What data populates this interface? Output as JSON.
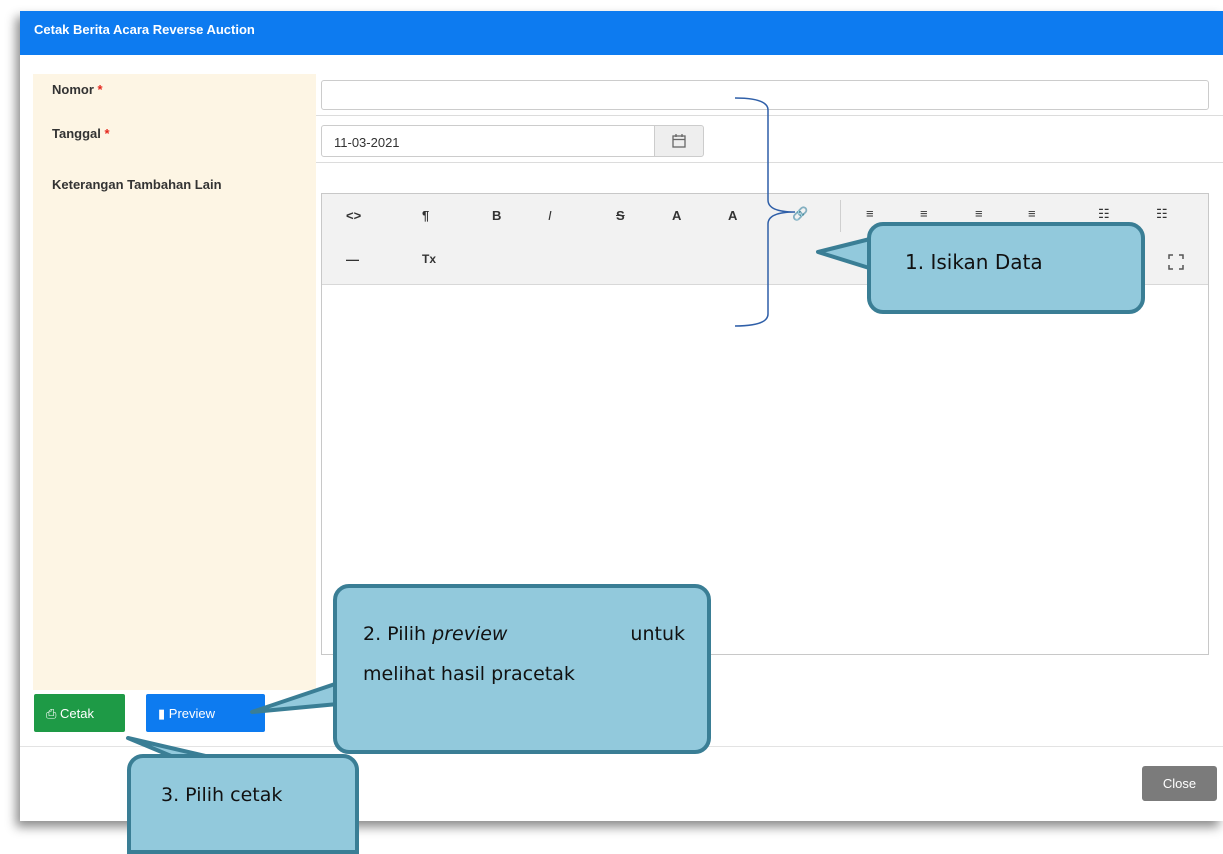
{
  "modal": {
    "title": "Cetak Berita Acara Reverse Auction",
    "required_mark": "*"
  },
  "form": {
    "nomor_label": "Nomor",
    "nomor_value": "",
    "tanggal_label": "Tanggal",
    "tanggal_value": "11-03-2021",
    "keterangan_label": "Keterangan Tambahan Lain"
  },
  "toolbar": {
    "row1": [
      "<>",
      "¶",
      "B",
      "I",
      "S",
      "A",
      "A",
      "🔗",
      "≡",
      "≡",
      "≡",
      "≡",
      "☷",
      "☷"
    ],
    "row2": [
      "—",
      "Tx"
    ]
  },
  "buttons": {
    "cetak": "Cetak",
    "preview": "Preview",
    "close": "Close"
  },
  "callouts": {
    "c1": "1.  Isikan Data",
    "c2_prefix": "2. Pilih ",
    "c2_em": "preview",
    "c2_suffix": " untuk",
    "c2_line2": "melihat hasil pracetak",
    "c3": "3. Pilih cetak"
  },
  "colors": {
    "header": "#0d7bf0",
    "cetak": "#1e9a46",
    "preview": "#0d7bf0",
    "callout_fill": "#92c9dc",
    "callout_border": "#3a7e95"
  }
}
